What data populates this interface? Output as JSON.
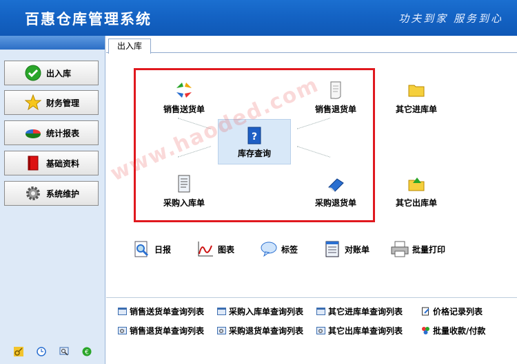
{
  "app": {
    "title": "百惠仓库管理系统",
    "slogan": "功夫到家 服务到心"
  },
  "sidebar": {
    "items": [
      {
        "label": "出入库",
        "icon": "check-icon"
      },
      {
        "label": "财务管理",
        "icon": "star-icon"
      },
      {
        "label": "统计报表",
        "icon": "pie-chart-icon"
      },
      {
        "label": "基础资料",
        "icon": "book-icon"
      },
      {
        "label": "系统维护",
        "icon": "gear-icon"
      }
    ],
    "footer_icons": [
      "key-icon",
      "clock-icon",
      "search-icon",
      "refresh-icon"
    ]
  },
  "tabs": [
    {
      "label": "出入库"
    }
  ],
  "flow": {
    "sales_delivery": "销售送货单",
    "sales_return": "销售退货单",
    "stock_query": "库存查询",
    "purchase_in": "采购入库单",
    "purchase_return": "采购退货单",
    "other_in": "其它进库单",
    "other_out": "其它出库单"
  },
  "tools": [
    {
      "label": "日报",
      "icon": "magnifier-report-icon"
    },
    {
      "label": "图表",
      "icon": "line-chart-icon"
    },
    {
      "label": "标签",
      "icon": "speech-bubble-icon"
    },
    {
      "label": "对账单",
      "icon": "ledger-icon"
    },
    {
      "label": "批量打印",
      "icon": "printer-icon"
    }
  ],
  "reports": {
    "row1": [
      "销售送货单查询列表",
      "采购入库单查询列表",
      "其它进库单查询列表",
      "价格记录列表"
    ],
    "row2": [
      "销售退货单查询列表",
      "采购退货单查询列表",
      "其它出库单查询列表",
      "批量收款/付款"
    ]
  },
  "watermark": "www.haoded.com",
  "colors": {
    "title_bar": "#1463c4",
    "highlight_border": "#e0181e",
    "sidebar_bg": "#dde9f7"
  }
}
